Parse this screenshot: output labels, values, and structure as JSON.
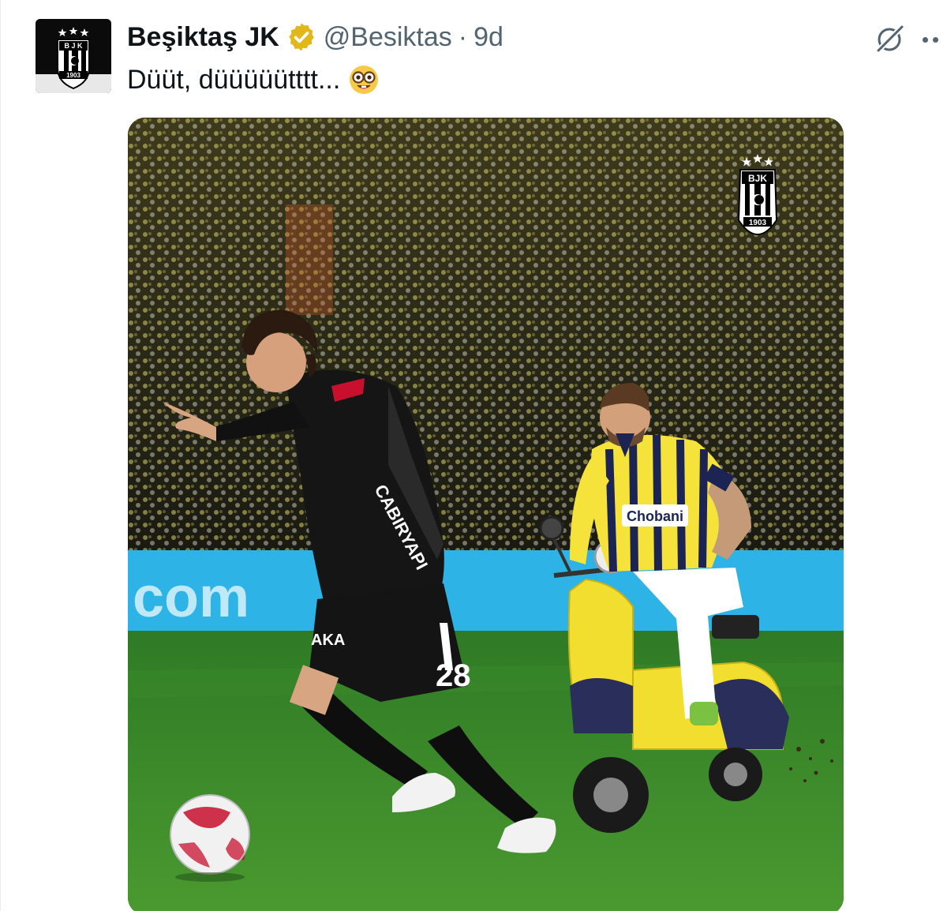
{
  "tweet": {
    "author": {
      "display_name": "Beşiktaş JK",
      "handle": "@Besiktas",
      "separator": "·",
      "time": "9d",
      "verified": true,
      "avatar_icon": "bjk-crest-icon"
    },
    "text": "Düüt, düüüüütttt...",
    "emoji": "nerd-face-emoji",
    "actions": {
      "grok_icon": "grok-icon",
      "more_icon": "more-dots-icon"
    },
    "media": {
      "type": "image",
      "crest_icon": "bjk-crest-icon",
      "crest_letters": "BJK",
      "crest_year": "1903",
      "sponsor_home": "CABIRYAPI",
      "sponsor_away": "Chobani",
      "player_number_home": "28",
      "board_text": "com",
      "shorts_text": "AKA"
    }
  },
  "colors": {
    "text_primary": "#0f1419",
    "text_secondary": "#536471",
    "verified_gold": "#e2b719",
    "pitch_green": "#3d8c2a",
    "board_blue": "#2db3e6",
    "fenerbahce_yellow": "#f5e33b",
    "fenerbahce_navy": "#1c2453"
  }
}
